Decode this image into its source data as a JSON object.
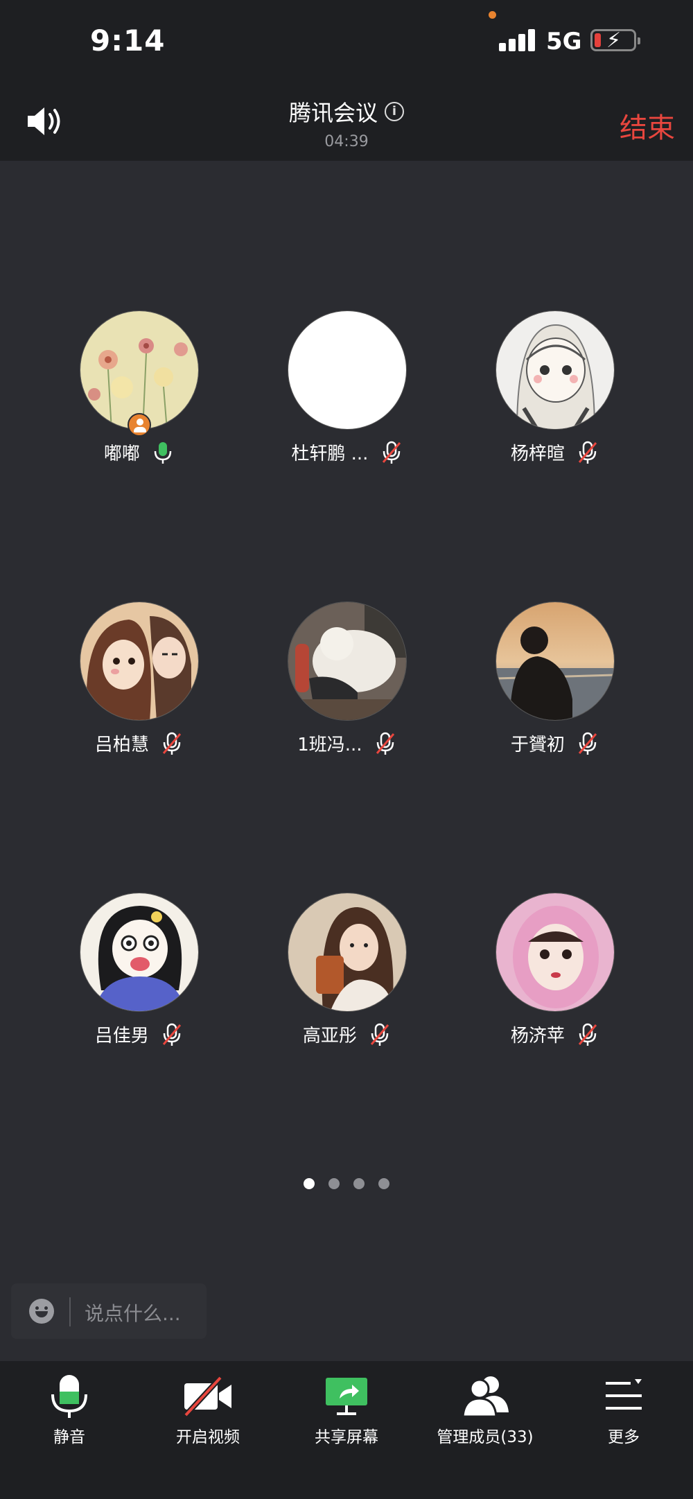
{
  "status_bar": {
    "time": "9:14",
    "network": "5G"
  },
  "header": {
    "title": "腾讯会议",
    "timer": "04:39",
    "end_label": "结束"
  },
  "participants": [
    {
      "name": "嘟嘟",
      "mic": "on",
      "host": true,
      "avatar": "flowers"
    },
    {
      "name": "杜轩鹏 ...",
      "mic": "muted",
      "host": false,
      "avatar": "blank"
    },
    {
      "name": "杨梓暄",
      "mic": "muted",
      "host": false,
      "avatar": "anime-girl"
    },
    {
      "name": "吕柏慧",
      "mic": "muted",
      "host": false,
      "avatar": "cartoon-couple"
    },
    {
      "name": "1班冯...",
      "mic": "muted",
      "host": false,
      "avatar": "white-dog"
    },
    {
      "name": "于贇初",
      "mic": "muted",
      "host": false,
      "avatar": "sunset-beach"
    },
    {
      "name": "吕佳男",
      "mic": "muted",
      "host": false,
      "avatar": "cartoon-girl"
    },
    {
      "name": "高亚彤",
      "mic": "muted",
      "host": false,
      "avatar": "girl-drink"
    },
    {
      "name": "杨济苹",
      "mic": "muted",
      "host": false,
      "avatar": "pink-hood-girl"
    }
  ],
  "pager": {
    "pages": 4,
    "current": 1
  },
  "chat": {
    "placeholder": "说点什么..."
  },
  "toolbar": {
    "mute_label": "静音",
    "video_label": "开启视频",
    "share_label": "共享屏幕",
    "members_label": "管理成员(33)",
    "more_label": "更多"
  },
  "colors": {
    "end": "#e8463e",
    "mic_on": "#3fc060",
    "mic_muted": "#e8463e",
    "share": "#3fc060",
    "host_badge": "#e8832f"
  }
}
